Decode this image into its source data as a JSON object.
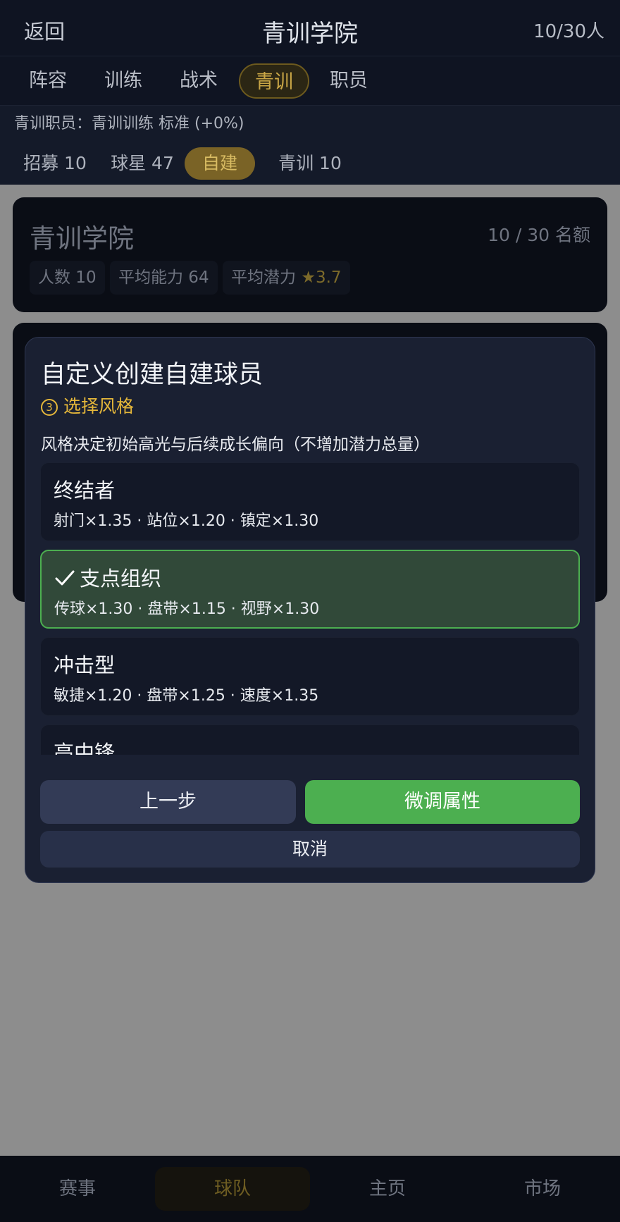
{
  "header": {
    "back_label": "返回",
    "title": "青训学院",
    "count": "10/30人"
  },
  "tabs": [
    {
      "label": "阵容"
    },
    {
      "label": "训练"
    },
    {
      "label": "战术"
    },
    {
      "label": "青训"
    },
    {
      "label": "职员"
    }
  ],
  "staff_line": "青训职员：青训训练 标准 (+0%)",
  "subtabs": [
    {
      "label": "招募 10"
    },
    {
      "label": "球星 47"
    },
    {
      "label": "自建"
    },
    {
      "label": "青训 10"
    }
  ],
  "academy": {
    "name": "青训学院",
    "quota": "10 / 30 名额",
    "stats": {
      "headcount": "人数 10",
      "avg_ability": "平均能力 64",
      "avg_potential_label": "平均潜力",
      "avg_potential_star": "★",
      "avg_potential_value": "3.7"
    }
  },
  "modal": {
    "title": "自定义创建自建球员",
    "step_number": "3",
    "step_label": "选择风格",
    "description": "风格决定初始高光与后续成长偏向（不增加潜力总量）",
    "options": [
      {
        "name": "终结者",
        "stats": "射门×1.35 · 站位×1.20 · 镇定×1.30",
        "selected": false
      },
      {
        "name": "支点组织",
        "stats": "传球×1.30 · 盘带×1.15 · 视野×1.30",
        "selected": true
      },
      {
        "name": "冲击型",
        "stats": "敏捷×1.20 · 盘带×1.25 · 速度×1.35",
        "selected": false
      },
      {
        "name": "高中锋",
        "stats": "",
        "selected": false
      }
    ],
    "prev_label": "上一步",
    "next_label": "微调属性",
    "cancel_label": "取消"
  },
  "bottom_nav": [
    {
      "label": "赛事"
    },
    {
      "label": "球队"
    },
    {
      "label": "主页"
    },
    {
      "label": "市场"
    }
  ],
  "colors": {
    "accent_green": "#4caf50",
    "accent_gold": "#e5b73a",
    "modal_bg": "#1a2032"
  }
}
